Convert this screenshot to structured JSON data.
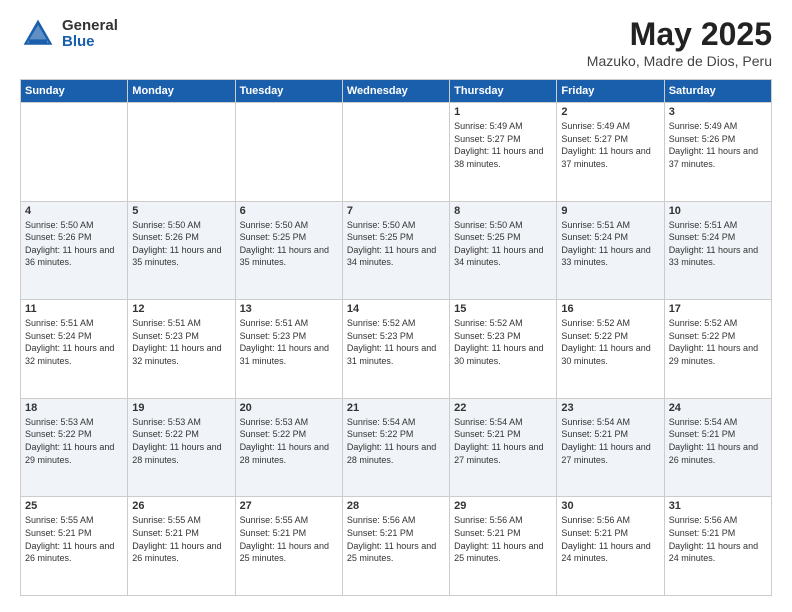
{
  "header": {
    "logo_general": "General",
    "logo_blue": "Blue",
    "title": "May 2025",
    "subtitle": "Mazuko, Madre de Dios, Peru"
  },
  "weekdays": [
    "Sunday",
    "Monday",
    "Tuesday",
    "Wednesday",
    "Thursday",
    "Friday",
    "Saturday"
  ],
  "weeks": [
    [
      {
        "day": "",
        "sunrise": "",
        "sunset": "",
        "daylight": ""
      },
      {
        "day": "",
        "sunrise": "",
        "sunset": "",
        "daylight": ""
      },
      {
        "day": "",
        "sunrise": "",
        "sunset": "",
        "daylight": ""
      },
      {
        "day": "",
        "sunrise": "",
        "sunset": "",
        "daylight": ""
      },
      {
        "day": "1",
        "sunrise": "Sunrise: 5:49 AM",
        "sunset": "Sunset: 5:27 PM",
        "daylight": "Daylight: 11 hours and 38 minutes."
      },
      {
        "day": "2",
        "sunrise": "Sunrise: 5:49 AM",
        "sunset": "Sunset: 5:27 PM",
        "daylight": "Daylight: 11 hours and 37 minutes."
      },
      {
        "day": "3",
        "sunrise": "Sunrise: 5:49 AM",
        "sunset": "Sunset: 5:26 PM",
        "daylight": "Daylight: 11 hours and 37 minutes."
      }
    ],
    [
      {
        "day": "4",
        "sunrise": "Sunrise: 5:50 AM",
        "sunset": "Sunset: 5:26 PM",
        "daylight": "Daylight: 11 hours and 36 minutes."
      },
      {
        "day": "5",
        "sunrise": "Sunrise: 5:50 AM",
        "sunset": "Sunset: 5:26 PM",
        "daylight": "Daylight: 11 hours and 35 minutes."
      },
      {
        "day": "6",
        "sunrise": "Sunrise: 5:50 AM",
        "sunset": "Sunset: 5:25 PM",
        "daylight": "Daylight: 11 hours and 35 minutes."
      },
      {
        "day": "7",
        "sunrise": "Sunrise: 5:50 AM",
        "sunset": "Sunset: 5:25 PM",
        "daylight": "Daylight: 11 hours and 34 minutes."
      },
      {
        "day": "8",
        "sunrise": "Sunrise: 5:50 AM",
        "sunset": "Sunset: 5:25 PM",
        "daylight": "Daylight: 11 hours and 34 minutes."
      },
      {
        "day": "9",
        "sunrise": "Sunrise: 5:51 AM",
        "sunset": "Sunset: 5:24 PM",
        "daylight": "Daylight: 11 hours and 33 minutes."
      },
      {
        "day": "10",
        "sunrise": "Sunrise: 5:51 AM",
        "sunset": "Sunset: 5:24 PM",
        "daylight": "Daylight: 11 hours and 33 minutes."
      }
    ],
    [
      {
        "day": "11",
        "sunrise": "Sunrise: 5:51 AM",
        "sunset": "Sunset: 5:24 PM",
        "daylight": "Daylight: 11 hours and 32 minutes."
      },
      {
        "day": "12",
        "sunrise": "Sunrise: 5:51 AM",
        "sunset": "Sunset: 5:23 PM",
        "daylight": "Daylight: 11 hours and 32 minutes."
      },
      {
        "day": "13",
        "sunrise": "Sunrise: 5:51 AM",
        "sunset": "Sunset: 5:23 PM",
        "daylight": "Daylight: 11 hours and 31 minutes."
      },
      {
        "day": "14",
        "sunrise": "Sunrise: 5:52 AM",
        "sunset": "Sunset: 5:23 PM",
        "daylight": "Daylight: 11 hours and 31 minutes."
      },
      {
        "day": "15",
        "sunrise": "Sunrise: 5:52 AM",
        "sunset": "Sunset: 5:23 PM",
        "daylight": "Daylight: 11 hours and 30 minutes."
      },
      {
        "day": "16",
        "sunrise": "Sunrise: 5:52 AM",
        "sunset": "Sunset: 5:22 PM",
        "daylight": "Daylight: 11 hours and 30 minutes."
      },
      {
        "day": "17",
        "sunrise": "Sunrise: 5:52 AM",
        "sunset": "Sunset: 5:22 PM",
        "daylight": "Daylight: 11 hours and 29 minutes."
      }
    ],
    [
      {
        "day": "18",
        "sunrise": "Sunrise: 5:53 AM",
        "sunset": "Sunset: 5:22 PM",
        "daylight": "Daylight: 11 hours and 29 minutes."
      },
      {
        "day": "19",
        "sunrise": "Sunrise: 5:53 AM",
        "sunset": "Sunset: 5:22 PM",
        "daylight": "Daylight: 11 hours and 28 minutes."
      },
      {
        "day": "20",
        "sunrise": "Sunrise: 5:53 AM",
        "sunset": "Sunset: 5:22 PM",
        "daylight": "Daylight: 11 hours and 28 minutes."
      },
      {
        "day": "21",
        "sunrise": "Sunrise: 5:54 AM",
        "sunset": "Sunset: 5:22 PM",
        "daylight": "Daylight: 11 hours and 28 minutes."
      },
      {
        "day": "22",
        "sunrise": "Sunrise: 5:54 AM",
        "sunset": "Sunset: 5:21 PM",
        "daylight": "Daylight: 11 hours and 27 minutes."
      },
      {
        "day": "23",
        "sunrise": "Sunrise: 5:54 AM",
        "sunset": "Sunset: 5:21 PM",
        "daylight": "Daylight: 11 hours and 27 minutes."
      },
      {
        "day": "24",
        "sunrise": "Sunrise: 5:54 AM",
        "sunset": "Sunset: 5:21 PM",
        "daylight": "Daylight: 11 hours and 26 minutes."
      }
    ],
    [
      {
        "day": "25",
        "sunrise": "Sunrise: 5:55 AM",
        "sunset": "Sunset: 5:21 PM",
        "daylight": "Daylight: 11 hours and 26 minutes."
      },
      {
        "day": "26",
        "sunrise": "Sunrise: 5:55 AM",
        "sunset": "Sunset: 5:21 PM",
        "daylight": "Daylight: 11 hours and 26 minutes."
      },
      {
        "day": "27",
        "sunrise": "Sunrise: 5:55 AM",
        "sunset": "Sunset: 5:21 PM",
        "daylight": "Daylight: 11 hours and 25 minutes."
      },
      {
        "day": "28",
        "sunrise": "Sunrise: 5:56 AM",
        "sunset": "Sunset: 5:21 PM",
        "daylight": "Daylight: 11 hours and 25 minutes."
      },
      {
        "day": "29",
        "sunrise": "Sunrise: 5:56 AM",
        "sunset": "Sunset: 5:21 PM",
        "daylight": "Daylight: 11 hours and 25 minutes."
      },
      {
        "day": "30",
        "sunrise": "Sunrise: 5:56 AM",
        "sunset": "Sunset: 5:21 PM",
        "daylight": "Daylight: 11 hours and 24 minutes."
      },
      {
        "day": "31",
        "sunrise": "Sunrise: 5:56 AM",
        "sunset": "Sunset: 5:21 PM",
        "daylight": "Daylight: 11 hours and 24 minutes."
      }
    ]
  ]
}
